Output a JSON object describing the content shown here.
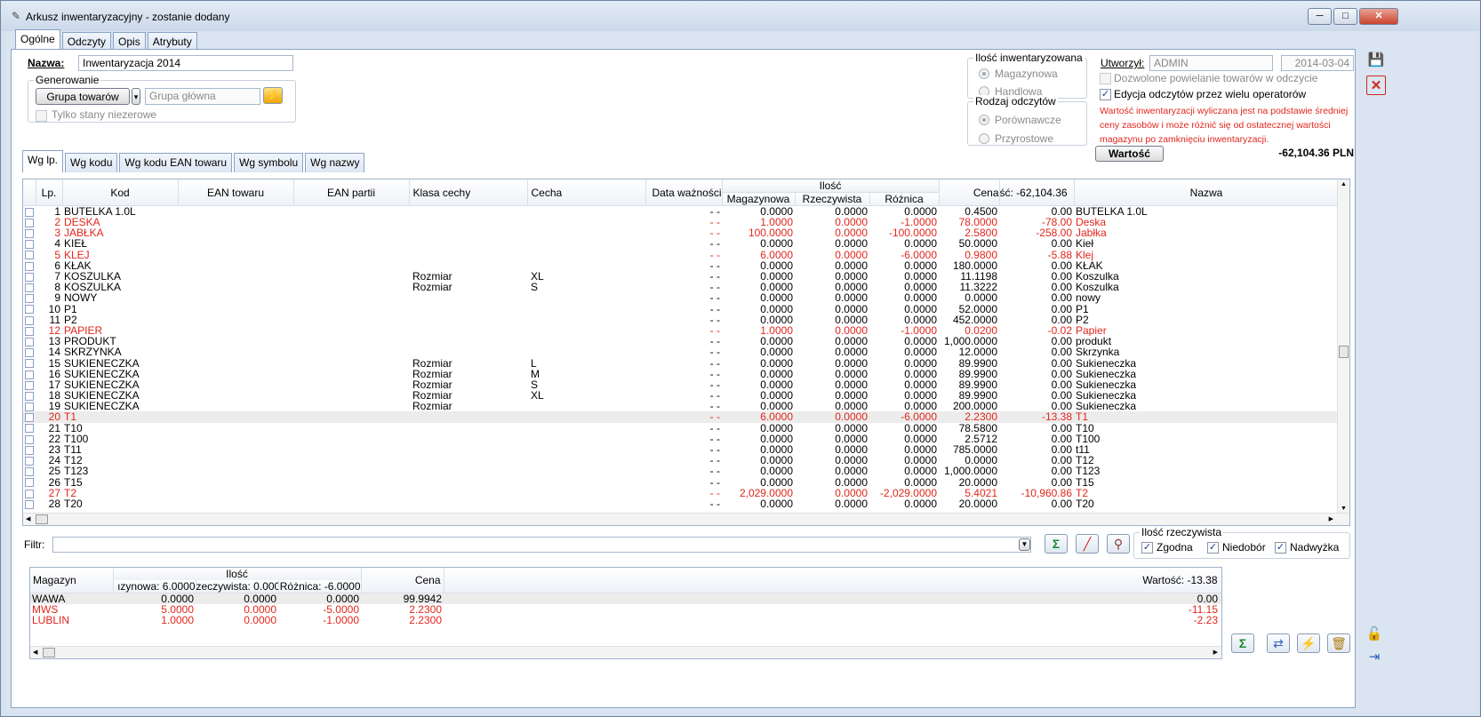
{
  "window": {
    "title": "Arkusz inwentaryzacyjny - zostanie dodany",
    "min": "─",
    "max": "□",
    "close": "✕"
  },
  "tabs": [
    "Ogólne",
    "Odczyty",
    "Opis",
    "Atrybuty"
  ],
  "form": {
    "nazwa_label": "Nazwa:",
    "nazwa_value": "Inwentaryzacja 2014",
    "generowanie_title": "Generowanie",
    "grupa_button": "Grupa towarów",
    "grupa_placeholder": "Grupa główna",
    "tylko_stany": "Tylko stany niezerowe",
    "ilosc_inw_title": "Ilość inwentaryzowana",
    "magazynowa": "Magazynowa",
    "handlowa": "Handlowa",
    "rodzaj_title": "Rodzaj odczytów",
    "porownawcze": "Porównawcze",
    "przyrostowe": "Przyrostowe",
    "utworzyl_label": "Utworzył:",
    "utworzyl_value": "ADMIN",
    "date": "2014-03-04",
    "dozwolone": "Dozwolone powielanie towarów w odczycie",
    "edycja": "Edycja odczytów przez wielu operatorów",
    "note": "Wartość inwentaryzacji wyliczana jest na podstawie średniej ceny zasobów i może różnić się od ostatecznej wartości magazynu po zamknięciu inwentaryzacji.",
    "wartosc_button": "Wartość",
    "wartosc_total": "-62,104.36 PLN"
  },
  "subtabs": [
    "Wg lp.",
    "Wg kodu",
    "Wg kodu EAN towaru",
    "Wg symbolu",
    "Wg nazwy"
  ],
  "grid": {
    "group_header": "Ilość",
    "headers": [
      "Lp.",
      "Kod",
      "EAN towaru",
      "EAN partii",
      "Klasa cechy",
      "Cecha",
      "Data ważności",
      "Magazynowa",
      "Rzeczywista",
      "Różnica",
      "Cena",
      "ść: -62,104.36",
      "Nazwa"
    ],
    "rows": [
      [
        "1",
        "BUTELKA 1.0L",
        "",
        "",
        "",
        "",
        "- -",
        "0.0000",
        "0.0000",
        "0.0000",
        "0.4500",
        "0.00",
        "BUTELKA 1.0L"
      ],
      [
        "2",
        "DESKA",
        "",
        "",
        "",
        "",
        "- -",
        "1.0000",
        "0.0000",
        "-1.0000",
        "78.0000",
        "-78.00",
        "Deska"
      ],
      [
        "3",
        "JABŁKA",
        "",
        "",
        "",
        "",
        "- -",
        "100.0000",
        "0.0000",
        "-100.0000",
        "2.5800",
        "-258.00",
        "Jabłka"
      ],
      [
        "4",
        "KIEŁ",
        "",
        "",
        "",
        "",
        "- -",
        "0.0000",
        "0.0000",
        "0.0000",
        "50.0000",
        "0.00",
        "Kieł"
      ],
      [
        "5",
        "KLEJ",
        "",
        "",
        "",
        "",
        "- -",
        "6.0000",
        "0.0000",
        "-6.0000",
        "0.9800",
        "-5.88",
        "Klej"
      ],
      [
        "6",
        "KŁAK",
        "",
        "",
        "",
        "",
        "- -",
        "0.0000",
        "0.0000",
        "0.0000",
        "180.0000",
        "0.00",
        "KŁAK"
      ],
      [
        "7",
        "KOSZULKA",
        "",
        "",
        "Rozmiar",
        "XL",
        "- -",
        "0.0000",
        "0.0000",
        "0.0000",
        "11.1198",
        "0.00",
        "Koszulka"
      ],
      [
        "8",
        "KOSZULKA",
        "",
        "",
        "Rozmiar",
        "S",
        "- -",
        "0.0000",
        "0.0000",
        "0.0000",
        "11.3222",
        "0.00",
        "Koszulka"
      ],
      [
        "9",
        "NOWY",
        "",
        "",
        "",
        "",
        "- -",
        "0.0000",
        "0.0000",
        "0.0000",
        "0.0000",
        "0.00",
        "nowy"
      ],
      [
        "10",
        "P1",
        "",
        "",
        "",
        "",
        "- -",
        "0.0000",
        "0.0000",
        "0.0000",
        "52.0000",
        "0.00",
        "P1"
      ],
      [
        "11",
        "P2",
        "",
        "",
        "",
        "",
        "- -",
        "0.0000",
        "0.0000",
        "0.0000",
        "452.0000",
        "0.00",
        "P2"
      ],
      [
        "12",
        "PAPIER",
        "",
        "",
        "",
        "",
        "- -",
        "1.0000",
        "0.0000",
        "-1.0000",
        "0.0200",
        "-0.02",
        "Papier"
      ],
      [
        "13",
        "PRODUKT",
        "",
        "",
        "",
        "",
        "- -",
        "0.0000",
        "0.0000",
        "0.0000",
        "1,000.0000",
        "0.00",
        "produkt"
      ],
      [
        "14",
        "SKRZYNKA",
        "",
        "",
        "",
        "",
        "- -",
        "0.0000",
        "0.0000",
        "0.0000",
        "12.0000",
        "0.00",
        "Skrzynka"
      ],
      [
        "15",
        "SUKIENECZKA",
        "",
        "",
        "Rozmiar",
        "L",
        "- -",
        "0.0000",
        "0.0000",
        "0.0000",
        "89.9900",
        "0.00",
        "Sukieneczka"
      ],
      [
        "16",
        "SUKIENECZKA",
        "",
        "",
        "Rozmiar",
        "M",
        "- -",
        "0.0000",
        "0.0000",
        "0.0000",
        "89.9900",
        "0.00",
        "Sukieneczka"
      ],
      [
        "17",
        "SUKIENECZKA",
        "",
        "",
        "Rozmiar",
        "S",
        "- -",
        "0.0000",
        "0.0000",
        "0.0000",
        "89.9900",
        "0.00",
        "Sukieneczka"
      ],
      [
        "18",
        "SUKIENECZKA",
        "",
        "",
        "Rozmiar",
        "XL",
        "- -",
        "0.0000",
        "0.0000",
        "0.0000",
        "89.9900",
        "0.00",
        "Sukieneczka"
      ],
      [
        "19",
        "SUKIENECZKA",
        "",
        "",
        "Rozmiar",
        "",
        "- -",
        "0.0000",
        "0.0000",
        "0.0000",
        "200.0000",
        "0.00",
        "Sukieneczka"
      ],
      [
        "20",
        "T1",
        "",
        "",
        "",
        "",
        "- -",
        "6.0000",
        "0.0000",
        "-6.0000",
        "2.2300",
        "-13.38",
        "T1"
      ],
      [
        "21",
        "T10",
        "",
        "",
        "",
        "",
        "- -",
        "0.0000",
        "0.0000",
        "0.0000",
        "78.5800",
        "0.00",
        "T10"
      ],
      [
        "22",
        "T100",
        "",
        "",
        "",
        "",
        "- -",
        "0.0000",
        "0.0000",
        "0.0000",
        "2.5712",
        "0.00",
        "T100"
      ],
      [
        "23",
        "T11",
        "",
        "",
        "",
        "",
        "- -",
        "0.0000",
        "0.0000",
        "0.0000",
        "785.0000",
        "0.00",
        "t11"
      ],
      [
        "24",
        "T12",
        "",
        "",
        "",
        "",
        "- -",
        "0.0000",
        "0.0000",
        "0.0000",
        "0.0000",
        "0.00",
        "T12"
      ],
      [
        "25",
        "T123",
        "",
        "",
        "",
        "",
        "- -",
        "0.0000",
        "0.0000",
        "0.0000",
        "1,000.0000",
        "0.00",
        "T123"
      ],
      [
        "26",
        "T15",
        "",
        "",
        "",
        "",
        "- -",
        "0.0000",
        "0.0000",
        "0.0000",
        "20.0000",
        "0.00",
        "T15"
      ],
      [
        "27",
        "T2",
        "",
        "",
        "",
        "",
        "- -",
        "2,029.0000",
        "0.0000",
        "-2,029.0000",
        "5.4021",
        "-10,960.86",
        "T2"
      ],
      [
        "28",
        "T20",
        "",
        "",
        "",
        "",
        "- -",
        "0.0000",
        "0.0000",
        "0.0000",
        "20.0000",
        "0.00",
        "T20"
      ]
    ],
    "red_rows": [
      1,
      2,
      4,
      11,
      19,
      26
    ],
    "selected_row": 19
  },
  "filter": {
    "label": "Filtr:",
    "value": ""
  },
  "ilosc_rzecz": {
    "title": "Ilość rzeczywista",
    "zgodna": "Zgodna",
    "niedobor": "Niedobór",
    "nadwyzka": "Nadwyżka"
  },
  "detail": {
    "h_magazyn": "Magazyn",
    "h_ilosc": "Ilość",
    "h_mag": "ızynowa: 6.0000",
    "h_rz": "zeczywista: 0.0000",
    "h_roz": "Różnica: -6.0000",
    "h_cena": "Cena",
    "h_wart": "Wartość: -13.38",
    "rows": [
      [
        "WAWA",
        "0.0000",
        "0.0000",
        "0.0000",
        "99.9942",
        "0.00"
      ],
      [
        "MWS",
        "5.0000",
        "0.0000",
        "-5.0000",
        "2.2300",
        "-11.15"
      ],
      [
        "LUBLIN",
        "1.0000",
        "0.0000",
        "-1.0000",
        "2.2300",
        "-2.23"
      ]
    ]
  },
  "colors": {
    "red": "#e1261c",
    "accent": "#2b63c0"
  }
}
